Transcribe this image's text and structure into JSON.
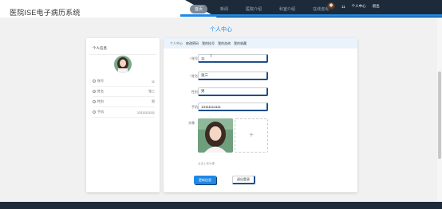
{
  "site": {
    "title": "医院ISE电子病历系统"
  },
  "nav": {
    "items": [
      "首页",
      "新闻",
      "医院介绍",
      "科室介绍",
      "在线咨询"
    ]
  },
  "user": {
    "name": "11",
    "center_label": "个人中心",
    "logout_label": "退出"
  },
  "page_title": "个人中心",
  "left_card": {
    "heading": "个人信息",
    "rows": [
      {
        "key": "账号",
        "value": "11"
      },
      {
        "key": "姓名",
        "value": "张三"
      },
      {
        "key": "性别",
        "value": "男"
      },
      {
        "key": "手机",
        "value": "13111111111"
      }
    ]
  },
  "tabs": [
    "个人中心",
    "修改密码",
    "我的挂号",
    "我的咨询",
    "我的收藏"
  ],
  "form": {
    "account": {
      "label": "账号",
      "value": "11"
    },
    "name": {
      "label": "姓名",
      "value": "张三"
    },
    "gender": {
      "label": "性别",
      "value": "男"
    },
    "phone": {
      "label": "手机",
      "value": "13111111111"
    },
    "avatar_label": "头像",
    "upload_hint": "点击上传头像",
    "save_label": "更新信息",
    "logout_label": "退出登录"
  },
  "colors": {
    "accent": "#1e88e5",
    "dark": "#1d2a3a"
  }
}
